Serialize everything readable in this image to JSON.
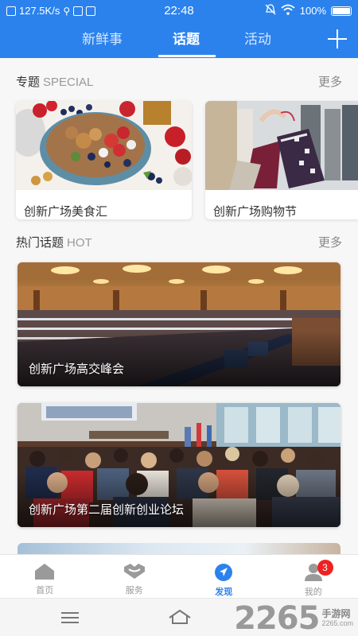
{
  "status_bar": {
    "speed": "127.5K/s",
    "time": "22:48",
    "battery": "100%"
  },
  "tabs": [
    {
      "label": "新鲜事",
      "active": false
    },
    {
      "label": "话题",
      "active": true
    },
    {
      "label": "活动",
      "active": false
    }
  ],
  "special": {
    "title": "专题",
    "title_en": "SPECIAL",
    "more": "更多",
    "cards": [
      {
        "label": "创新广场美食汇"
      },
      {
        "label": "创新广场购物节"
      }
    ]
  },
  "hot": {
    "title": "热门话题",
    "title_en": "HOT",
    "more": "更多",
    "cards": [
      {
        "label": "创新广场高交峰会"
      },
      {
        "label": "创新广场第二届创新创业论坛"
      }
    ]
  },
  "bottom_nav": [
    {
      "label": "首页",
      "icon": "home-icon"
    },
    {
      "label": "服务",
      "icon": "service-icon"
    },
    {
      "label": "发现",
      "icon": "discover-compass-icon"
    },
    {
      "label": "我的",
      "icon": "profile-icon",
      "badge": "3"
    }
  ],
  "watermark": {
    "number": "2265",
    "text": "手游网",
    "sub": "2265.com"
  },
  "colors": {
    "primary": "#2b82ed",
    "badge": "#e22222"
  }
}
